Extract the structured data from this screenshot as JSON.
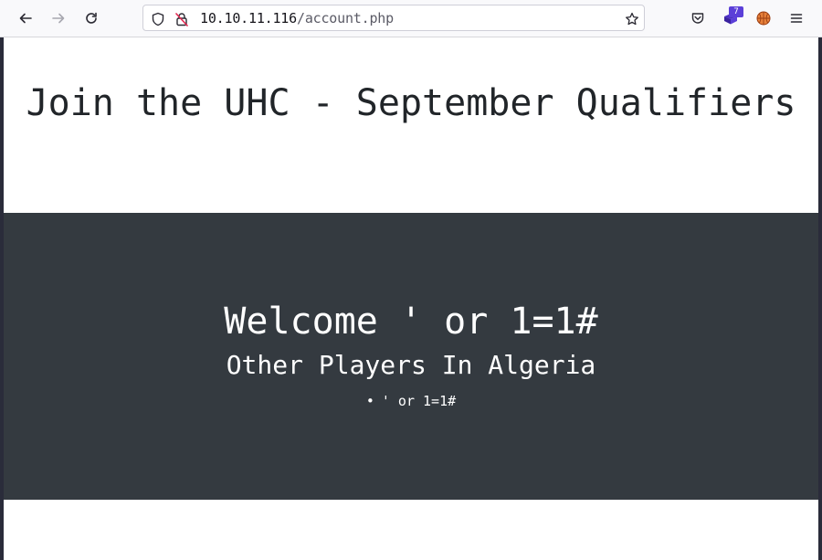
{
  "browser": {
    "url_host": "10.10.11.116",
    "url_path": "/account.php",
    "extension_badge": "7",
    "icons": {
      "back": "back-arrow-icon",
      "forward": "forward-arrow-icon",
      "reload": "reload-icon",
      "shield": "shield-icon",
      "insecure": "insecure-lock-icon",
      "bookmark": "star-icon",
      "pocket": "pocket-icon",
      "extension": "extension-icon",
      "profile": "basketball-icon",
      "menu": "hamburger-menu-icon"
    }
  },
  "page": {
    "title": "Join the UHC - September Qualifiers",
    "welcome": "Welcome ' or 1=1#",
    "subtitle": "Other Players In Algeria",
    "players": [
      "' or 1=1#"
    ]
  },
  "colors": {
    "dark_section": "#343a40",
    "title_text": "#212529"
  }
}
